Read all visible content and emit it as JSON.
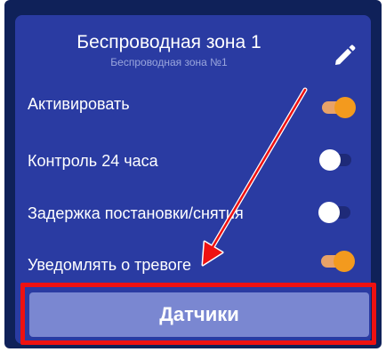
{
  "zone": {
    "title": "Беспроводная зона 1",
    "subtitle": "Беспроводная зона №1"
  },
  "settings": [
    {
      "label": "Активировать",
      "state": "on"
    },
    {
      "label": "Контроль 24 часа",
      "state": "off"
    },
    {
      "label": "Задержка постановки/снятия",
      "state": "off"
    },
    {
      "label": "Уведомлять о тревоге",
      "state": "on"
    }
  ],
  "sensors_button": {
    "label": "Датчики"
  },
  "colors": {
    "background": "#0f2159",
    "card": "#2a3ba2",
    "toggle_on": "#f39a1e",
    "toggle_off": "#ffffff",
    "button": "#7a87d1",
    "annotation": "#ee1111"
  },
  "icons": {
    "edit": "pencil-icon"
  }
}
